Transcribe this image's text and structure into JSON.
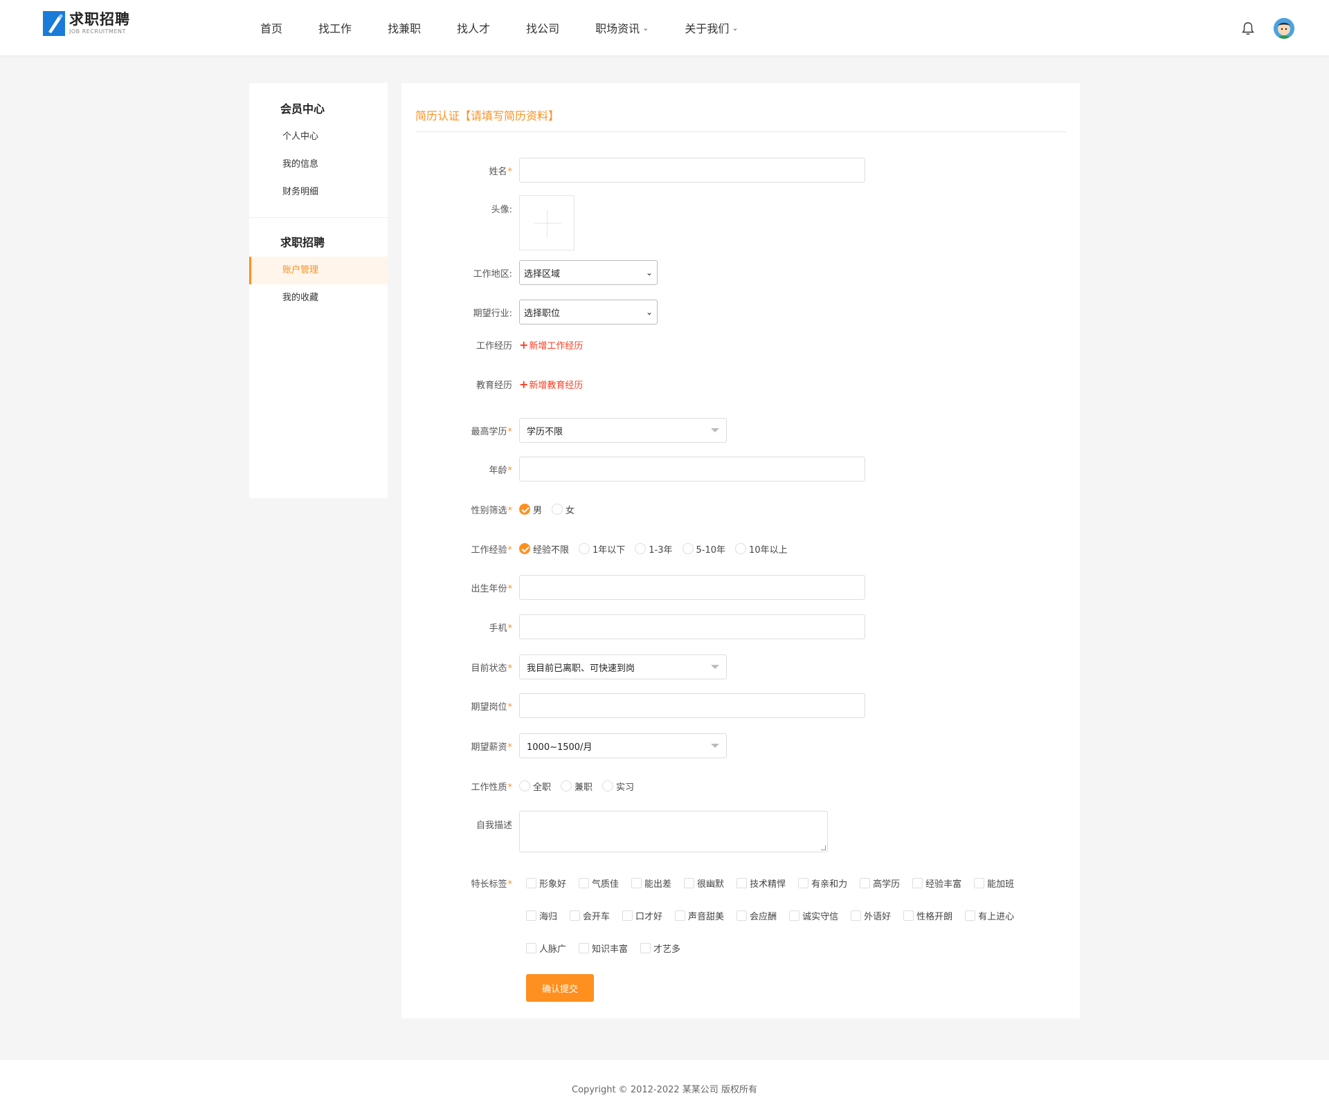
{
  "header": {
    "logo_title": "求职招聘",
    "logo_sub": "JOB RECRUITMENT",
    "nav": [
      {
        "label": "首页",
        "has_menu": false
      },
      {
        "label": "找工作",
        "has_menu": false
      },
      {
        "label": "找兼职",
        "has_menu": false
      },
      {
        "label": "找人才",
        "has_menu": false
      },
      {
        "label": "找公司",
        "has_menu": false
      },
      {
        "label": "职场资讯",
        "has_menu": true
      },
      {
        "label": "关于我们",
        "has_menu": true
      }
    ],
    "bell_icon": "bell-icon",
    "avatar_icon": "user-avatar-icon"
  },
  "sidebar": {
    "groups": [
      {
        "title": "会员中心",
        "items": [
          "个人中心",
          "我的信息",
          "财务明细"
        ]
      },
      {
        "title": "求职招聘",
        "items": [
          "账户管理",
          "我的收藏"
        ]
      }
    ],
    "active_item": "账户管理"
  },
  "form": {
    "page_title": "简历认证【请填写简历资料】",
    "fields": {
      "name_label": "姓名",
      "avatar_label": "头像:",
      "area_label": "工作地区:",
      "area_value": "选择区域",
      "industry_label": "期望行业:",
      "industry_value": "选择职位",
      "work_exp_label": "工作经历",
      "work_exp_link": "新增工作经历",
      "edu_label": "教育经历",
      "edu_link": "新增教育经历",
      "degree_label": "最高学历",
      "degree_value": "学历不限",
      "age_label": "年龄",
      "gender_label": "性别筛选",
      "gender_options": [
        "男",
        "女"
      ],
      "gender_selected": 0,
      "experience_label": "工作经验",
      "experience_options": [
        "经验不限",
        "1年以下",
        "1-3年",
        "5-10年",
        "10年以上"
      ],
      "experience_selected": 0,
      "birth_label": "出生年份",
      "phone_label": "手机",
      "status_label": "目前状态",
      "status_value": "我目前已离职、可快速到岗",
      "position_label": "期望岗位",
      "salary_label": "期望薪资",
      "salary_value": "1000~1500/月",
      "jobtype_label": "工作性质",
      "jobtype_options": [
        "全职",
        "兼职",
        "实习"
      ],
      "desc_label": "自我描述",
      "tags_label": "特长标签",
      "tags": [
        [
          "形象好",
          "气质佳",
          "能出差",
          "很幽默",
          "技术精悍",
          "有亲和力",
          "高学历",
          "经验丰富",
          "能加班"
        ],
        [
          "海归",
          "会开车",
          "口才好",
          "声音甜美",
          "会应酬",
          "诚实守信",
          "外语好",
          "性格开朗",
          "有上进心"
        ],
        [
          "人脉广",
          "知识丰富",
          "才艺多"
        ]
      ]
    },
    "submit_label": "确认提交"
  },
  "footer": {
    "copyright": "Copyright © 2012-2022 某某公司 版权所有"
  },
  "colors": {
    "accent": "#ff8f1f",
    "link_red": "#ff3b1f",
    "brand_blue": "#1a7bd8"
  }
}
